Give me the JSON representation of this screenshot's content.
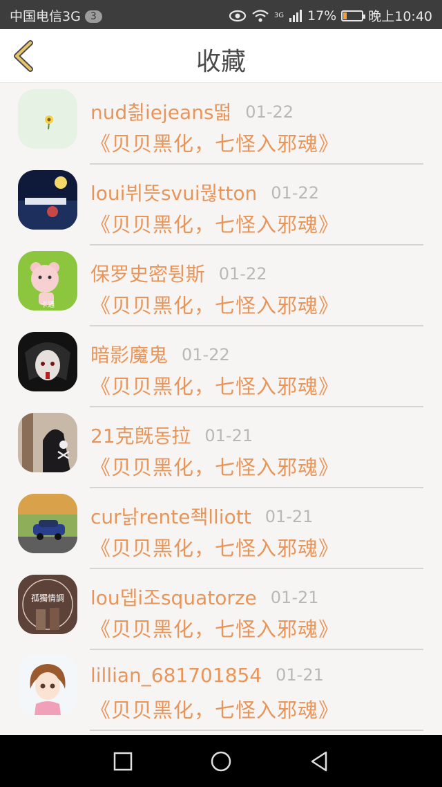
{
  "status_bar": {
    "carrier": "中国电信3G",
    "notification_count": "3",
    "signal_type": "3G",
    "battery_percent": "17%",
    "battery_level": 0.17,
    "time": "晚上10:40"
  },
  "header": {
    "title": "收藏",
    "back_icon": "chevron-left-icon",
    "accent_color": "#e8c46a"
  },
  "items": [
    {
      "name": "nud칆iejeans떫",
      "date": "01-22",
      "title": "《贝贝黑化，七怪入邪魂》",
      "avatar": "flower-avatar"
    },
    {
      "name": "loui뷔뜻svui뭖tton",
      "date": "01-22",
      "title": "《贝贝黑化，七怪入邪魂》",
      "avatar": "night-scene-avatar"
    },
    {
      "name": "保罗史密튕斯",
      "date": "01-22",
      "title": "《贝贝黑化，七怪入邪魂》",
      "avatar": "bear-avatar",
      "avatar_text": "卡通"
    },
    {
      "name": "暗影魔鬼",
      "date": "01-22",
      "title": "《贝贝黑化，七怪入邪魂》",
      "avatar": "dark-anime-avatar"
    },
    {
      "name": "21克旣동拉",
      "date": "01-21",
      "title": "《贝贝黑化，七怪入邪魂》",
      "avatar": "skull-hoodie-avatar"
    },
    {
      "name": "cur낡rente좩lliott",
      "date": "01-21",
      "title": "《贝贝黑化，七怪入邪魂》",
      "avatar": "car-avatar"
    },
    {
      "name": "lou뎁i조squatorze",
      "date": "01-21",
      "title": "《贝贝黑化，七怪入邪魂》",
      "avatar": "couple-avatar",
      "avatar_text": "孤獨情調"
    },
    {
      "name": "lillian_681701854",
      "date": "01-21",
      "title": "《贝贝黑化，七怪入邪魂》",
      "avatar": "cartoon-girl-avatar"
    }
  ],
  "colors": {
    "name_text": "#e8955a",
    "date_text": "#b8b8b8",
    "background": "#f7f5f4"
  },
  "nav_bar": {
    "buttons": [
      "square-icon",
      "circle-icon",
      "back-triangle-icon"
    ]
  }
}
